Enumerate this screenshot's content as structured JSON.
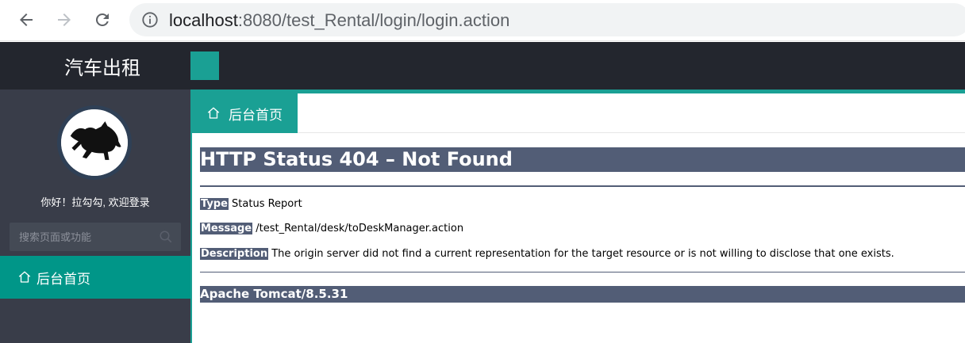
{
  "browser": {
    "url_host": "localhost",
    "url_rest": ":8080/test_Rental/login/login.action"
  },
  "app": {
    "brand": "汽车出租",
    "welcome": "你好！拉勾勾, 欢迎登录",
    "search_placeholder": "搜索页面或功能",
    "sidebar_active_item": "后台首页",
    "tab_label": "后台首页"
  },
  "error_page": {
    "title": "HTTP Status 404 – Not Found",
    "type_label": "Type",
    "type_value": " Status Report",
    "message_label": "Message",
    "message_value": " /test_Rental/desk/toDeskManager.action",
    "description_label": "Description",
    "description_value": " The origin server did not find a current representation for the target resource or is not willing to disclose that one exists.",
    "footer": "Apache Tomcat/8.5.31"
  },
  "colors": {
    "header_bg": "#23262e",
    "sidebar_bg": "#393d49",
    "accent": "#009688",
    "tab_accent": "#1aa094",
    "tomcat_bar": "#525d76"
  },
  "icons": [
    "back-arrow-icon",
    "forward-arrow-icon",
    "reload-icon",
    "info-icon",
    "horse-logo-icon",
    "search-icon",
    "home-icon"
  ]
}
